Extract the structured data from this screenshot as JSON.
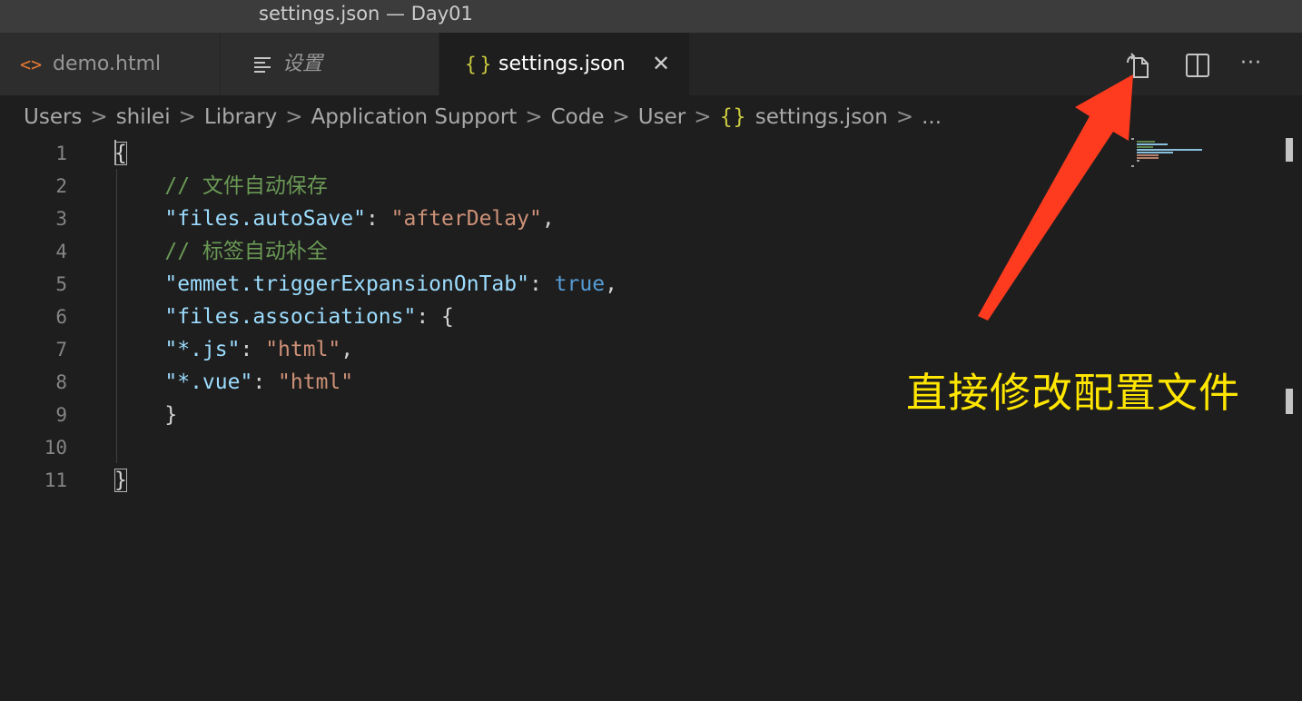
{
  "window": {
    "title": "settings.json — Day01"
  },
  "tabs": [
    {
      "label": "demo.html",
      "icon": "html-brackets-icon",
      "active": false,
      "italic": false
    },
    {
      "label": "设置",
      "icon": "settings-list-icon",
      "active": false,
      "italic": true
    },
    {
      "label": "settings.json",
      "icon": "json-braces-icon",
      "active": true,
      "italic": false
    }
  ],
  "tab_icons": {
    "html": "<>",
    "json": "{}",
    "close": "✕"
  },
  "toolbar": {
    "actions": [
      "open-settings-ui-icon",
      "split-editor-icon",
      "more-actions-icon"
    ],
    "more_label": "···"
  },
  "breadcrumb": {
    "items": [
      "Users",
      "shilei",
      "Library",
      "Application Support",
      "Code",
      "User",
      "settings.json",
      "..."
    ],
    "separator": ">",
    "json_braces": "{}"
  },
  "editor": {
    "line_numbers": [
      "1",
      "2",
      "3",
      "4",
      "5",
      "6",
      "7",
      "8",
      "9",
      "10",
      "11"
    ],
    "lines": [
      [
        {
          "t": "{",
          "c": "punct"
        }
      ],
      [
        {
          "t": "    // 文件自动保存",
          "c": "comment"
        }
      ],
      [
        {
          "t": "    ",
          "c": "punct"
        },
        {
          "t": "\"files.autoSave\"",
          "c": "key"
        },
        {
          "t": ": ",
          "c": "punct"
        },
        {
          "t": "\"afterDelay\"",
          "c": "str"
        },
        {
          "t": ",",
          "c": "punct"
        }
      ],
      [
        {
          "t": "    // 标签自动补全",
          "c": "comment"
        }
      ],
      [
        {
          "t": "    ",
          "c": "punct"
        },
        {
          "t": "\"emmet.triggerExpansionOnTab\"",
          "c": "key"
        },
        {
          "t": ": ",
          "c": "punct"
        },
        {
          "t": "true",
          "c": "bool"
        },
        {
          "t": ",",
          "c": "punct"
        }
      ],
      [
        {
          "t": "    ",
          "c": "punct"
        },
        {
          "t": "\"files.associations\"",
          "c": "key"
        },
        {
          "t": ": {",
          "c": "punct"
        }
      ],
      [
        {
          "t": "    ",
          "c": "punct"
        },
        {
          "t": "\"*.js\"",
          "c": "key"
        },
        {
          "t": ": ",
          "c": "punct"
        },
        {
          "t": "\"html\"",
          "c": "str"
        },
        {
          "t": ",",
          "c": "punct"
        }
      ],
      [
        {
          "t": "    ",
          "c": "punct"
        },
        {
          "t": "\"*.vue\"",
          "c": "key"
        },
        {
          "t": ": ",
          "c": "punct"
        },
        {
          "t": "\"html\"",
          "c": "str"
        }
      ],
      [
        {
          "t": "    }",
          "c": "punct"
        }
      ],
      [
        {
          "t": "",
          "c": "punct"
        }
      ],
      [
        {
          "t": "}",
          "c": "punct"
        }
      ]
    ]
  },
  "colors": {
    "comment": "#6a9955",
    "key": "#9cdcfe",
    "string": "#ce9178",
    "boolean": "#569cd6",
    "annotation": "#ffe600",
    "arrow": "#ff3b1f"
  },
  "annotation": {
    "text": "直接修改配置文件"
  }
}
